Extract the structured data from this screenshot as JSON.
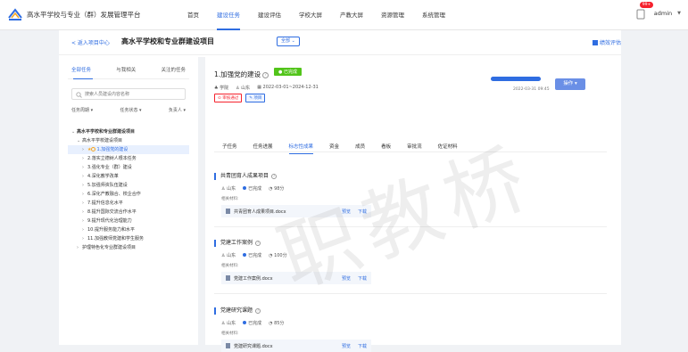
{
  "app": {
    "title": "高水平学校与专业（群）发展管理平台",
    "nav": [
      "首页",
      "建设任务",
      "建设评估",
      "学校大屏",
      "产教大屏",
      "资源管理",
      "系统管理"
    ],
    "active_nav": 1,
    "user": {
      "name": "admin",
      "badge": "99+"
    }
  },
  "header": {
    "back_label": "< 返入项目中心",
    "title": "高水平学校和专业群建设项目",
    "scope_select": "全部",
    "side_link": "绩效评估"
  },
  "sidebar": {
    "tabs": [
      "全部任务",
      "与我相关",
      "关注的任务"
    ],
    "active_tab": 0,
    "search_placeholder": "搜索人员建设内容名称",
    "filters": [
      "任务周期 ▾",
      "任务状态 ▾",
      "负责人 ▾"
    ],
    "tree": [
      {
        "label": "高水平学校和专业群建设项目",
        "level": 0,
        "arrow": "⌄"
      },
      {
        "label": "高水平学校建设项目",
        "level": 1,
        "arrow": "⌄"
      },
      {
        "label": "1.加强党的建设",
        "level": 2,
        "arrow": "›",
        "selected": true,
        "star": true
      },
      {
        "label": "2.落实立德树人根本任务",
        "level": 2,
        "arrow": "›"
      },
      {
        "label": "3.强化专业（群）建设",
        "level": 2,
        "arrow": "›"
      },
      {
        "label": "4.深化教学改革",
        "level": 2,
        "arrow": "›"
      },
      {
        "label": "5.加强师资队伍建设",
        "level": 2,
        "arrow": "›"
      },
      {
        "label": "6.深化产教融合、校企合作",
        "level": 2,
        "arrow": "›"
      },
      {
        "label": "7.提升信息化水平",
        "level": 2,
        "arrow": "›"
      },
      {
        "label": "8.提升国际交流合作水平",
        "level": 2,
        "arrow": "›"
      },
      {
        "label": "9.提升现代化治理能力",
        "level": 2,
        "arrow": "›"
      },
      {
        "label": "10.提升服务能力和水平",
        "level": 2,
        "arrow": "›"
      },
      {
        "label": "11.加强教师党建和学生服务",
        "level": 2,
        "arrow": "›"
      },
      {
        "label": "护理特色化专业群建设项目",
        "level": 1,
        "arrow": "›"
      }
    ]
  },
  "task": {
    "title": "1.加强党的建设",
    "status": "● 已完成",
    "meta": {
      "dept": "学院",
      "owner": "山东",
      "period": "2022-03-01~2024-12-31"
    },
    "tags": [
      "⊙ 审核通过",
      "✎ 项目"
    ],
    "progress": {
      "percent": 100,
      "label": "",
      "date": "2022-03-31 09:45"
    },
    "op_button": "操作 ▾",
    "tabs": [
      "子任务",
      "任务进展",
      "标志性成果",
      "资金",
      "成员",
      "看板",
      "审批流",
      "佐证材料"
    ],
    "active_tab": 2
  },
  "sections": [
    {
      "title": "共青团育人成果项目",
      "owner": "山东",
      "status": "已完成",
      "score": "98分",
      "mat_label": "相关材料:",
      "file": "共青团育人成果项目.docx",
      "preview": "预览",
      "download": "下载"
    },
    {
      "title": "党建工作案例",
      "owner": "山东",
      "status": "已完成",
      "score": "100分",
      "mat_label": "相关材料:",
      "file": "党建工作案例.docx",
      "preview": "预览",
      "download": "下载"
    },
    {
      "title": "党建研究课题",
      "owner": "山东",
      "status": "已完成",
      "score": "85分",
      "mat_label": "相关材料:",
      "file": "党建研究课题.docx",
      "preview": "预览",
      "download": "下载"
    }
  ],
  "watermark": "职教桥",
  "colors": {
    "accent": "#2f6de1",
    "success": "#52c41a",
    "warning": "#f5a623",
    "danger": "#f5222d"
  }
}
